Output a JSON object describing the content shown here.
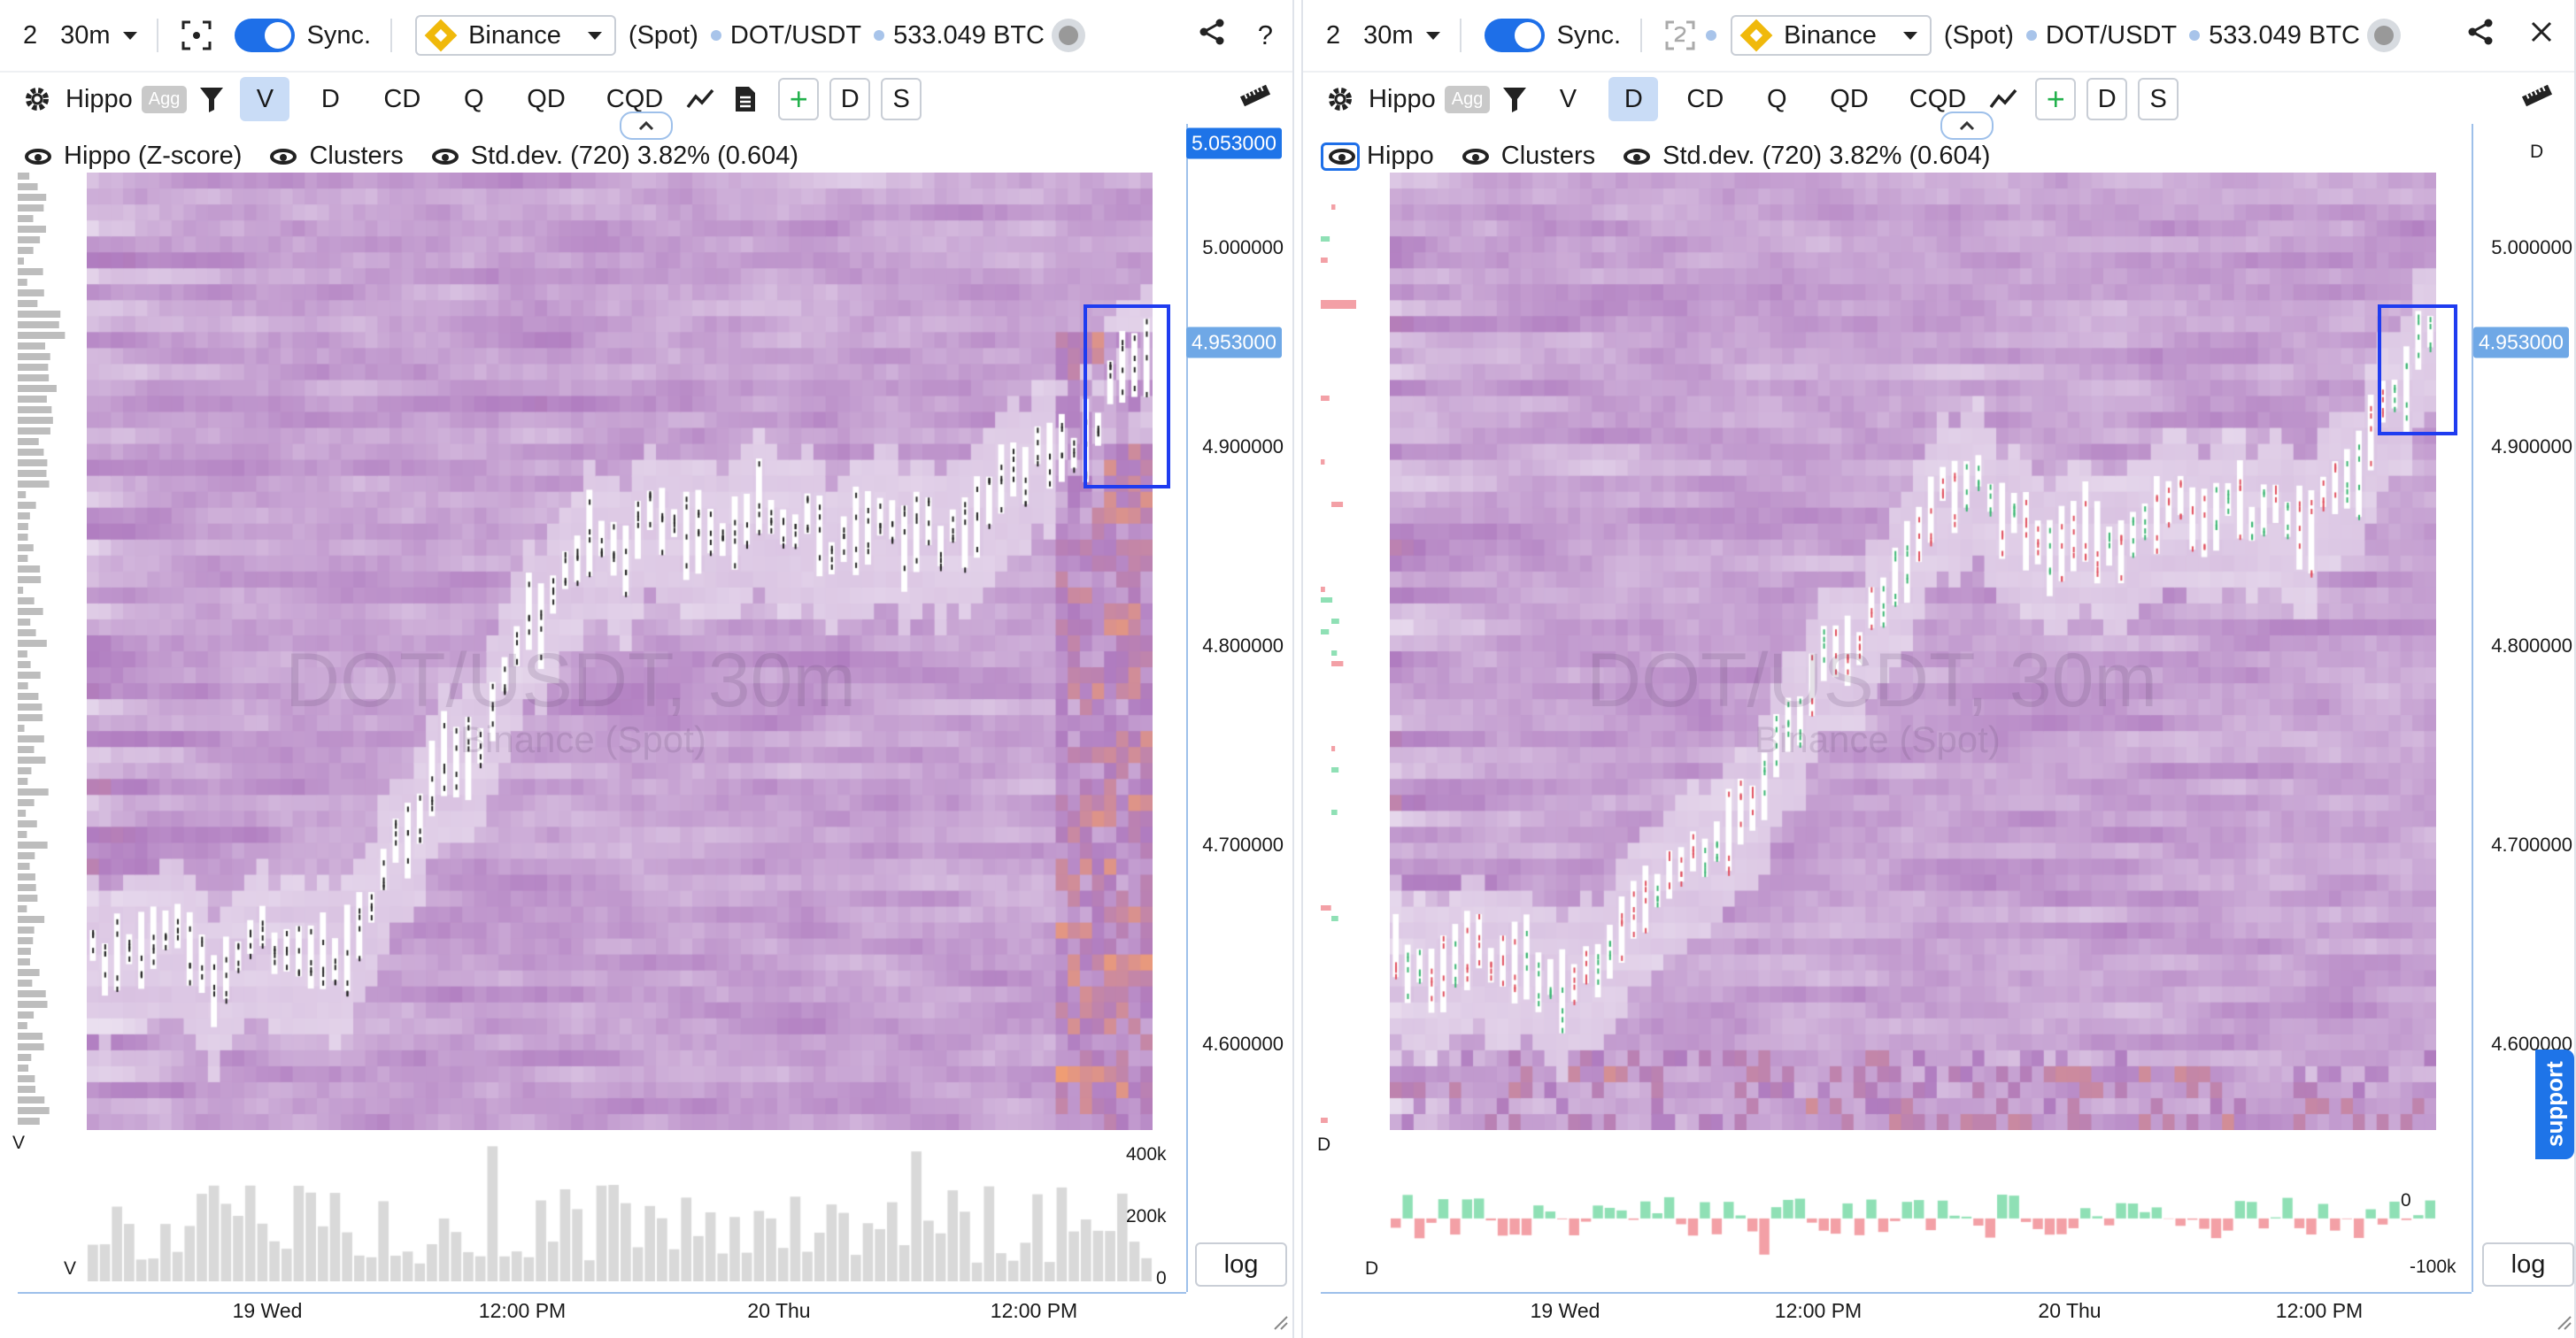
{
  "panels": [
    {
      "layout_count": "2",
      "timeframe": "30m",
      "sync_label": "Sync.",
      "exchange": "Binance",
      "market": "(Spot)",
      "pair": "DOT/USDT",
      "volume": "533.049 BTC",
      "indicator": "Hippo",
      "indicator_badge": "Agg",
      "modes": [
        "V",
        "D",
        "CD",
        "Q",
        "QD",
        "CQD"
      ],
      "active_mode": "V",
      "extra_buttons": [
        "D",
        "S"
      ],
      "legend": {
        "main": "Hippo (Z-score)",
        "clusters": "Clusters",
        "stddev": "Std.dev. (720) 3.82% (0.604)"
      },
      "price_labels": [
        "5.000000",
        "4.900000",
        "4.800000",
        "4.700000",
        "4.600000"
      ],
      "current_price": "4.953000",
      "top_price": "5.053000",
      "sub_label": "V",
      "sub_ticks": [
        "400k",
        "200k",
        "0"
      ],
      "time_labels": [
        "19 Wed",
        "12:00 PM",
        "20 Thu",
        "12:00 PM"
      ],
      "log_label": "log",
      "watermark": "DOT/USDT, 30m",
      "watermark_sub": "Binance (Spot)"
    },
    {
      "layout_count": "2",
      "timeframe": "30m",
      "sync_label": "Sync.",
      "exchange": "Binance",
      "market": "(Spot)",
      "pair": "DOT/USDT",
      "volume": "533.049 BTC",
      "indicator": "Hippo",
      "indicator_badge": "Agg",
      "modes": [
        "V",
        "D",
        "CD",
        "Q",
        "QD",
        "CQD"
      ],
      "active_mode": "D",
      "extra_buttons": [
        "D",
        "S"
      ],
      "legend": {
        "main": "Hippo",
        "clusters": "Clusters",
        "stddev": "Std.dev. (720) 3.82% (0.604)"
      },
      "price_labels": [
        "5.000000",
        "4.900000",
        "4.800000",
        "4.700000",
        "4.600000"
      ],
      "current_price": "4.953000",
      "axis_label": "D",
      "sub_label": "D",
      "sub_ticks": [
        "0",
        "-100k"
      ],
      "time_labels": [
        "19 Wed",
        "12:00 PM",
        "20 Thu",
        "12:00 PM"
      ],
      "log_label": "log",
      "watermark": "DOT/USDT, 30m",
      "watermark_sub": "Binance (Spot)",
      "support_label": "support"
    }
  ],
  "colors": {
    "accent": "#1e6fe8",
    "price_tag": "#6fa8e6",
    "top_tag": "#1e74e8",
    "selection": "#1f3cf0",
    "heat_low": "#ece2f1",
    "heat_mid": "#b07cc0",
    "heat_high": "#f5a06e",
    "delta_pos": "#8fe0b5",
    "delta_neg": "#f3a0a6"
  },
  "icons": [
    "settings-gear-icon",
    "filter-icon",
    "line-chart-icon",
    "document-icon",
    "ruler-icon",
    "share-icon",
    "help-icon",
    "close-icon",
    "eye-icon",
    "chevron-up-icon",
    "crosshair-icon"
  ]
}
